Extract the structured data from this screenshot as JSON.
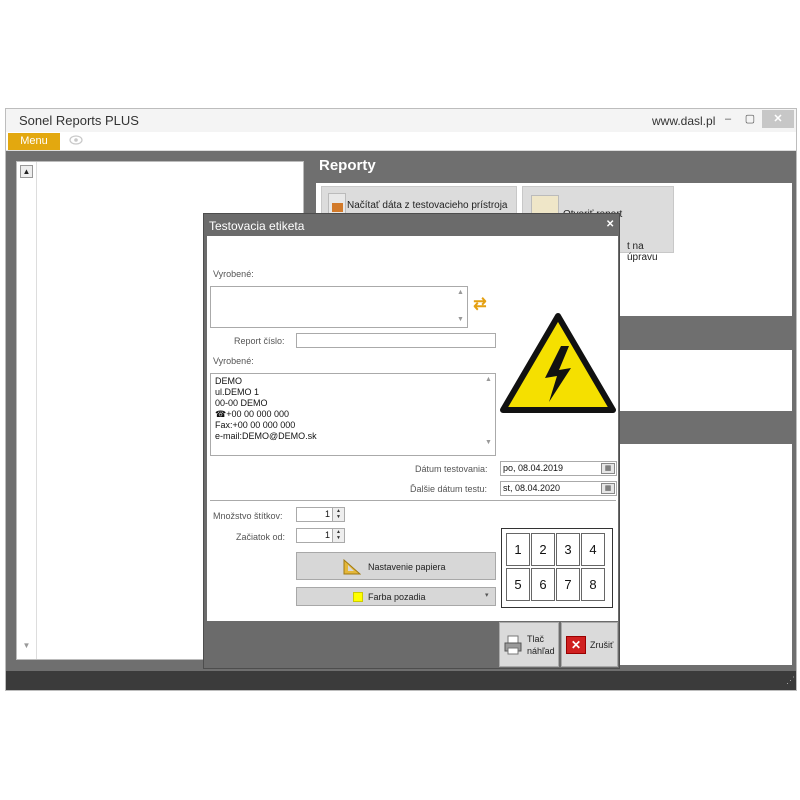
{
  "window": {
    "title": "Sonel Reports PLUS",
    "url": "www.dasl.pl",
    "minimize": "–",
    "maximize": "▢",
    "close": "✕"
  },
  "menubar": {
    "menu_label": "Menu"
  },
  "left_panel": {
    "scroll_up": "▲",
    "scroll_down": "▼"
  },
  "main": {
    "title": "Reporty",
    "tiles": [
      {
        "label": "Načítať dáta z testovacieho prístroja"
      },
      {
        "label_top": "Otvoriť report",
        "label_bottom": "t na úpravu"
      }
    ]
  },
  "dialog": {
    "title": "Testovacia etiketa",
    "close": "✕",
    "vyrobene1_label": "Vyrobené:",
    "vyrobene1_value": "",
    "report_cislo_label": "Report číslo:",
    "report_cislo_value": "",
    "vyrobene2_label": "Vyrobené:",
    "address_lines": [
      "DEMO",
      "ul.DEMO 1",
      "00-00 DEMO",
      "☎+00 00 000 000",
      "Fax:+00 00 000 000",
      "e-mail:DEMO@DEMO.sk"
    ],
    "datum_testovania_label": "Dátum testovania:",
    "datum_testovania_value": "po, 08.04.2019",
    "dalsie_datum_label": "Ďalšie dátum testu:",
    "dalsie_datum_value": "st, 08.04.2020",
    "mnozstvo_label": "Množstvo štítkov:",
    "mnozstvo_value": "1",
    "zaciatok_label": "Začiatok od:",
    "zaciatok_value": "1",
    "nastavenie_papiera": "Nastavenie papiera",
    "farba_pozadia": "Farba pozadia",
    "farba_color": "#ffff00",
    "grid_cells": [
      "1",
      "2",
      "3",
      "4",
      "5",
      "6",
      "7",
      "8"
    ],
    "tlac_label_1": "Tlač",
    "tlac_label_2": "náhľad",
    "zrusit_label": "Zrušiť",
    "cal_icon": "▦"
  },
  "colors": {
    "accent": "#e3a80f",
    "background": "#6f6f6f",
    "warning_yellow": "#f5e000"
  }
}
